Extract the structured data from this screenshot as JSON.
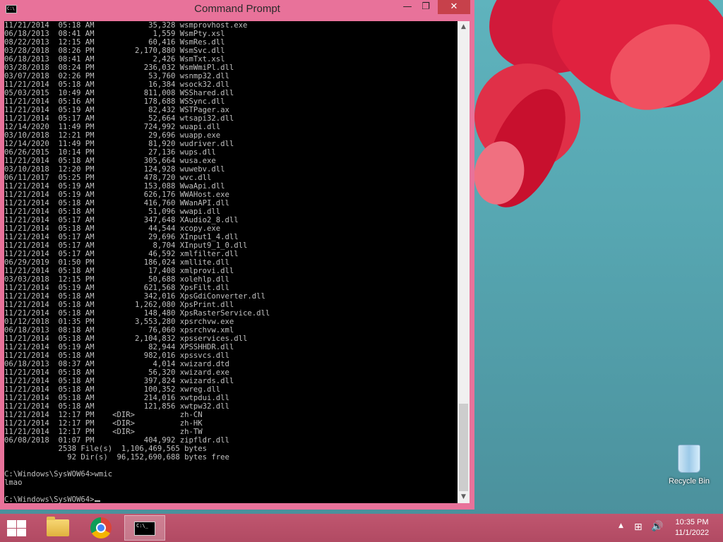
{
  "window": {
    "title": "Command Prompt",
    "icon_text": "C:\\",
    "minimize_glyph": "—",
    "maximize_glyph": "❐",
    "close_glyph": "✕"
  },
  "console": {
    "lines": [
      "11/21/2014  05:18 AM            35,328 wsmprovhost.exe",
      "06/18/2013  08:41 AM             1,559 WsmPty.xsl",
      "08/22/2013  12:15 AM            60,416 WsmRes.dll",
      "03/28/2018  08:26 PM         2,170,880 WsmSvc.dll",
      "06/18/2013  08:41 AM             2,426 WsmTxt.xsl",
      "03/28/2018  08:24 PM           236,032 WsmWmiPl.dll",
      "03/07/2018  02:26 PM            53,760 wsnmp32.dll",
      "11/21/2014  05:18 AM            16,384 wsock32.dll",
      "05/03/2015  10:49 AM           811,008 WSShared.dll",
      "11/21/2014  05:16 AM           178,688 WSSync.dll",
      "11/21/2014  05:19 AM            82,432 WSTPager.ax",
      "11/21/2014  05:17 AM            52,664 wtsapi32.dll",
      "12/14/2020  11:49 PM           724,992 wuapi.dll",
      "03/10/2018  12:21 PM            29,696 wuapp.exe",
      "12/14/2020  11:49 PM            81,920 wudriver.dll",
      "06/26/2015  10:14 PM            27,136 wups.dll",
      "11/21/2014  05:18 AM           305,664 wusa.exe",
      "03/10/2018  12:20 PM           124,928 wuwebv.dll",
      "06/11/2017  05:25 PM           478,720 wvc.dll",
      "11/21/2014  05:19 AM           153,088 WwaApi.dll",
      "11/21/2014  05:19 AM           626,176 WWAHost.exe",
      "11/21/2014  05:18 AM           416,760 WWanAPI.dll",
      "11/21/2014  05:18 AM            51,096 wwapi.dll",
      "11/21/2014  05:17 AM           347,648 XAudio2_8.dll",
      "11/21/2014  05:18 AM            44,544 xcopy.exe",
      "11/21/2014  05:17 AM            29,696 XInput1_4.dll",
      "11/21/2014  05:17 AM             8,704 XInput9_1_0.dll",
      "11/21/2014  05:17 AM            46,592 xmlfilter.dll",
      "06/29/2019  01:50 PM           186,024 xmllite.dll",
      "11/21/2014  05:18 AM            17,408 xmlprovi.dll",
      "03/03/2018  12:15 PM            50,688 xolehlp.dll",
      "11/21/2014  05:19 AM           621,568 XpsFilt.dll",
      "11/21/2014  05:18 AM           342,016 XpsGdiConverter.dll",
      "11/21/2014  05:18 AM         1,262,080 XpsPrint.dll",
      "11/21/2014  05:18 AM           148,480 XpsRasterService.dll",
      "01/12/2018  01:35 PM         3,553,280 xpsrchvw.exe",
      "06/18/2013  08:18 AM            76,060 xpsrchvw.xml",
      "11/21/2014  05:18 AM         2,104,832 xpsservices.dll",
      "11/21/2014  05:19 AM            82,944 XPSSHHDR.dll",
      "11/21/2014  05:18 AM           982,016 xpssvcs.dll",
      "06/18/2013  08:37 AM             4,014 xwizard.dtd",
      "11/21/2014  05:18 AM            56,320 xwizard.exe",
      "11/21/2014  05:18 AM           397,824 xwizards.dll",
      "11/21/2014  05:18 AM           100,352 xwreg.dll",
      "11/21/2014  05:18 AM           214,016 xwtpdui.dll",
      "11/21/2014  05:18 AM           121,856 xwtpw32.dll",
      "11/21/2014  12:17 PM    <DIR>          zh-CN",
      "11/21/2014  12:17 PM    <DIR>          zh-HK",
      "11/21/2014  12:17 PM    <DIR>          zh-TW",
      "06/08/2018  01:07 PM           404,992 zipfldr.dll",
      "            2538 File(s)  1,106,469,565 bytes",
      "              92 Dir(s)  96,152,690,688 bytes free",
      "",
      "C:\\Windows\\SysWOW64>wmic",
      "lmao",
      "",
      "C:\\Windows\\SysWOW64>"
    ]
  },
  "scrollbar": {
    "up_glyph": "▲",
    "down_glyph": "▼"
  },
  "desktop": {
    "recycle_bin_label": "Recycle Bin"
  },
  "taskbar": {
    "cmd_icon_text": "C:\\_",
    "tray_arrow": "▲",
    "network_glyph": "⊞",
    "volume_glyph": "🔊",
    "time": "10:35 PM",
    "date": "11/1/2022"
  }
}
